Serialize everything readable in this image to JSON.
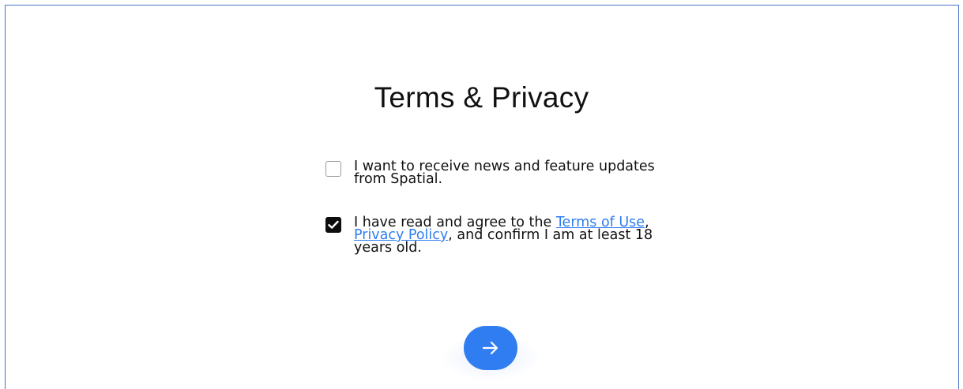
{
  "page": {
    "title": "Terms & Privacy"
  },
  "options": {
    "news": {
      "checked": false,
      "text": "I want to receive news and feature updates from Spatial."
    },
    "terms": {
      "checked": true,
      "text_before": "I have read and agree to the ",
      "terms_link": "Terms of Use",
      "separator": ", ",
      "privacy_link": "Privacy Policy",
      "text_after": ", and confirm I am at least 18 years old."
    }
  },
  "next_button": {
    "icon": "arrow-right-icon"
  },
  "colors": {
    "accent": "#2f7df0",
    "frame_border": "#4a73c4",
    "checkbox_checked": "#0d0d0d",
    "text": "#111111"
  }
}
